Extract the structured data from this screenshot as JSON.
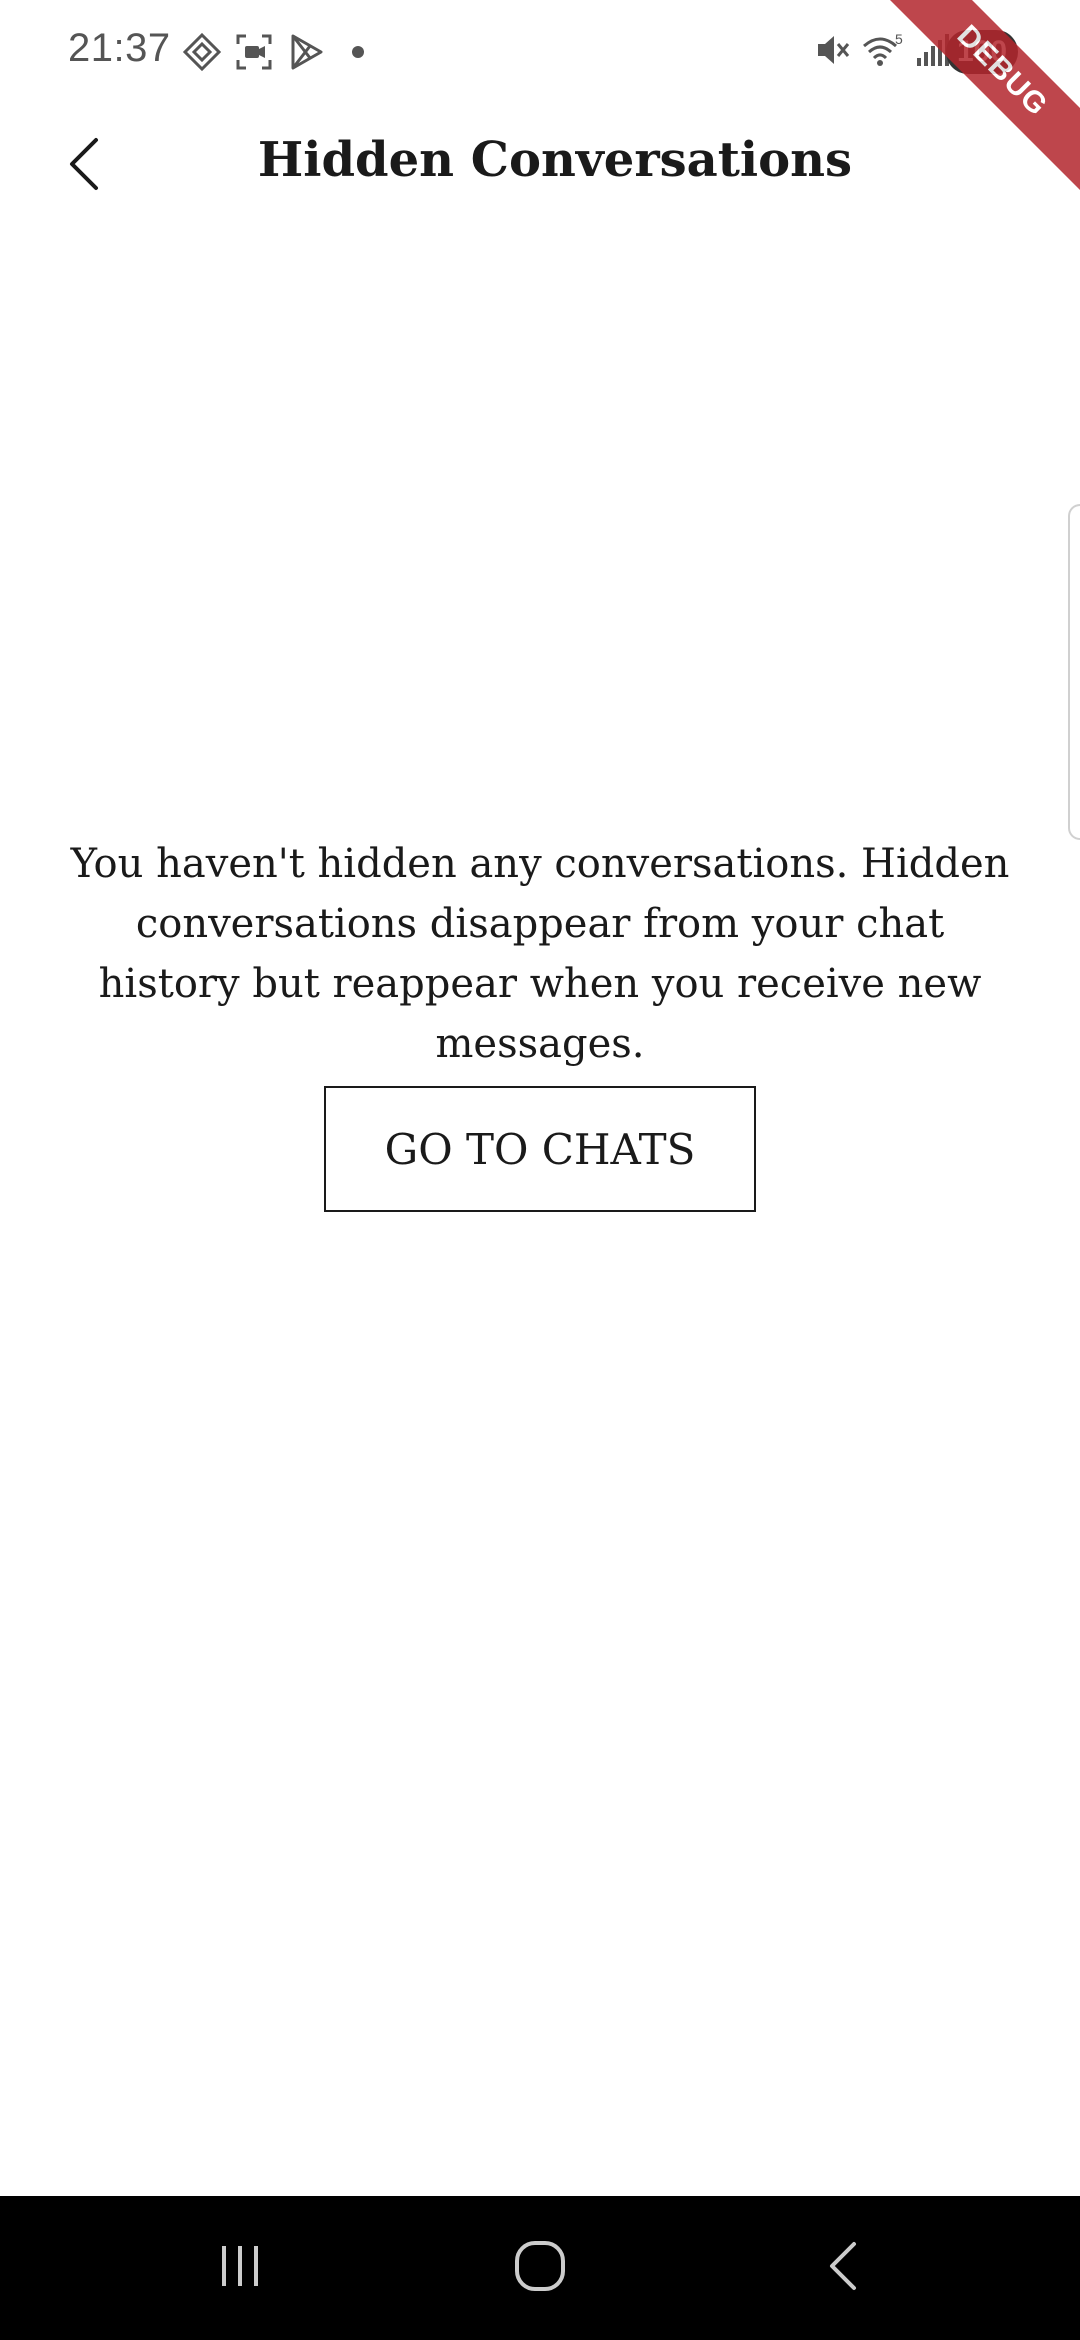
{
  "status_bar": {
    "time": "21:37",
    "battery": "100",
    "left_icons": [
      "diamond-icon",
      "screen-record-icon",
      "play-store-icon",
      "notification-dot-icon"
    ],
    "right_icons": [
      "mute-icon",
      "wifi-icon",
      "signal-icon"
    ],
    "wifi_label": "5"
  },
  "debug_banner": {
    "label": "DEBUG"
  },
  "app_bar": {
    "title": "Hidden Conversations",
    "back_icon": "chevron-left-icon"
  },
  "empty_state": {
    "message": "You haven't hidden any conversations. Hidden conversations disappear from your chat history but reappear when you receive new messages.",
    "button_label": "GO TO CHATS"
  },
  "nav_bar": {
    "buttons": [
      "recents-icon",
      "home-icon",
      "back-icon"
    ]
  },
  "colors": {
    "background": "#ffffff",
    "text": "#1a1a1a",
    "debug_banner": "#b3262d",
    "nav_bar": "#000000"
  }
}
